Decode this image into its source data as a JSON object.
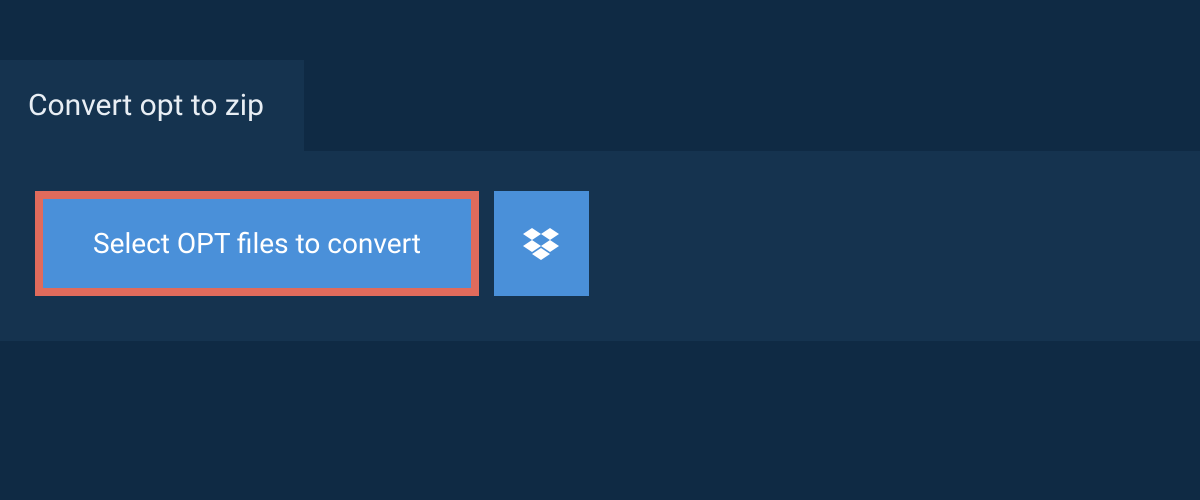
{
  "tab": {
    "title": "Convert opt to zip"
  },
  "actions": {
    "select_files_label": "Select OPT files to convert"
  },
  "colors": {
    "background": "#0f2a44",
    "panel": "#15334f",
    "button": "#4a90d9",
    "highlight_border": "#e06b5c",
    "text_light": "#e8eef4"
  }
}
